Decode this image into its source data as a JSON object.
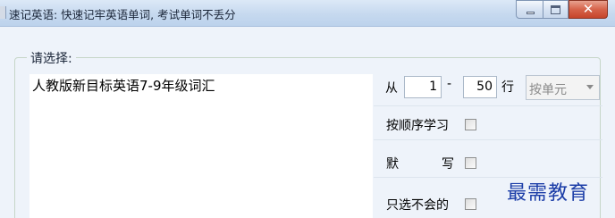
{
  "window": {
    "title": "速记英语: 快速记牢英语单词, 考试单词不丢分",
    "buttons": {
      "minimize": "minimize",
      "maximize": "maximize",
      "close": "✕"
    }
  },
  "group": {
    "legend": "请选择:"
  },
  "wordlist": {
    "items": [
      "人教版新目标英语7-9年级词汇"
    ]
  },
  "range": {
    "from_label": "从",
    "from_value": "1",
    "dash": "-",
    "to_value": "50",
    "unit_label": "行",
    "mode_select": "按单元"
  },
  "options": {
    "sequential_label": "按顺序学习",
    "dictation_label_1": "默",
    "dictation_label_2": "写",
    "only_unknown_label": "只选不会的"
  },
  "watermark": {
    "text": "最需教育"
  },
  "colors": {
    "titlebar": "#c6d9ef",
    "close_button": "#d6634a",
    "watermark": "#1c3ea8"
  }
}
